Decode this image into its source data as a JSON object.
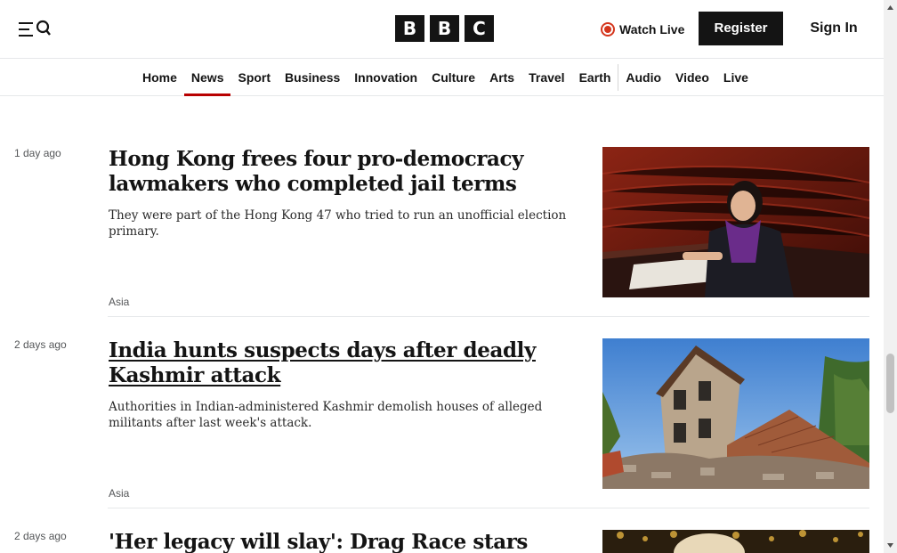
{
  "header": {
    "logo": [
      "B",
      "B",
      "C"
    ],
    "watch_live": "Watch Live",
    "register": "Register",
    "sign_in": "Sign In"
  },
  "nav": {
    "items": [
      "Home",
      "News",
      "Sport",
      "Business",
      "Innovation",
      "Culture",
      "Arts",
      "Travel",
      "Earth",
      "Audio",
      "Video",
      "Live"
    ],
    "active": "News"
  },
  "articles": [
    {
      "timestamp": "1 day ago",
      "headline": "Hong Kong frees four pro-democracy lawmakers who completed jail terms",
      "summary": "They were part of the Hong Kong 47 who tried to run an unofficial election primary.",
      "tag": "Asia"
    },
    {
      "timestamp": "2 days ago",
      "headline": "India hunts suspects days after deadly Kashmir attack",
      "summary": "Authorities in Indian-administered Kashmir demolish houses of alleged militants after last week's attack.",
      "tag": "Asia"
    },
    {
      "timestamp": "2 days ago",
      "headline": "'Her legacy will slay': Drag Race stars mourn"
    }
  ],
  "colors": {
    "accent": "#b80000",
    "live_red": "#d4351c",
    "text": "#141414"
  }
}
